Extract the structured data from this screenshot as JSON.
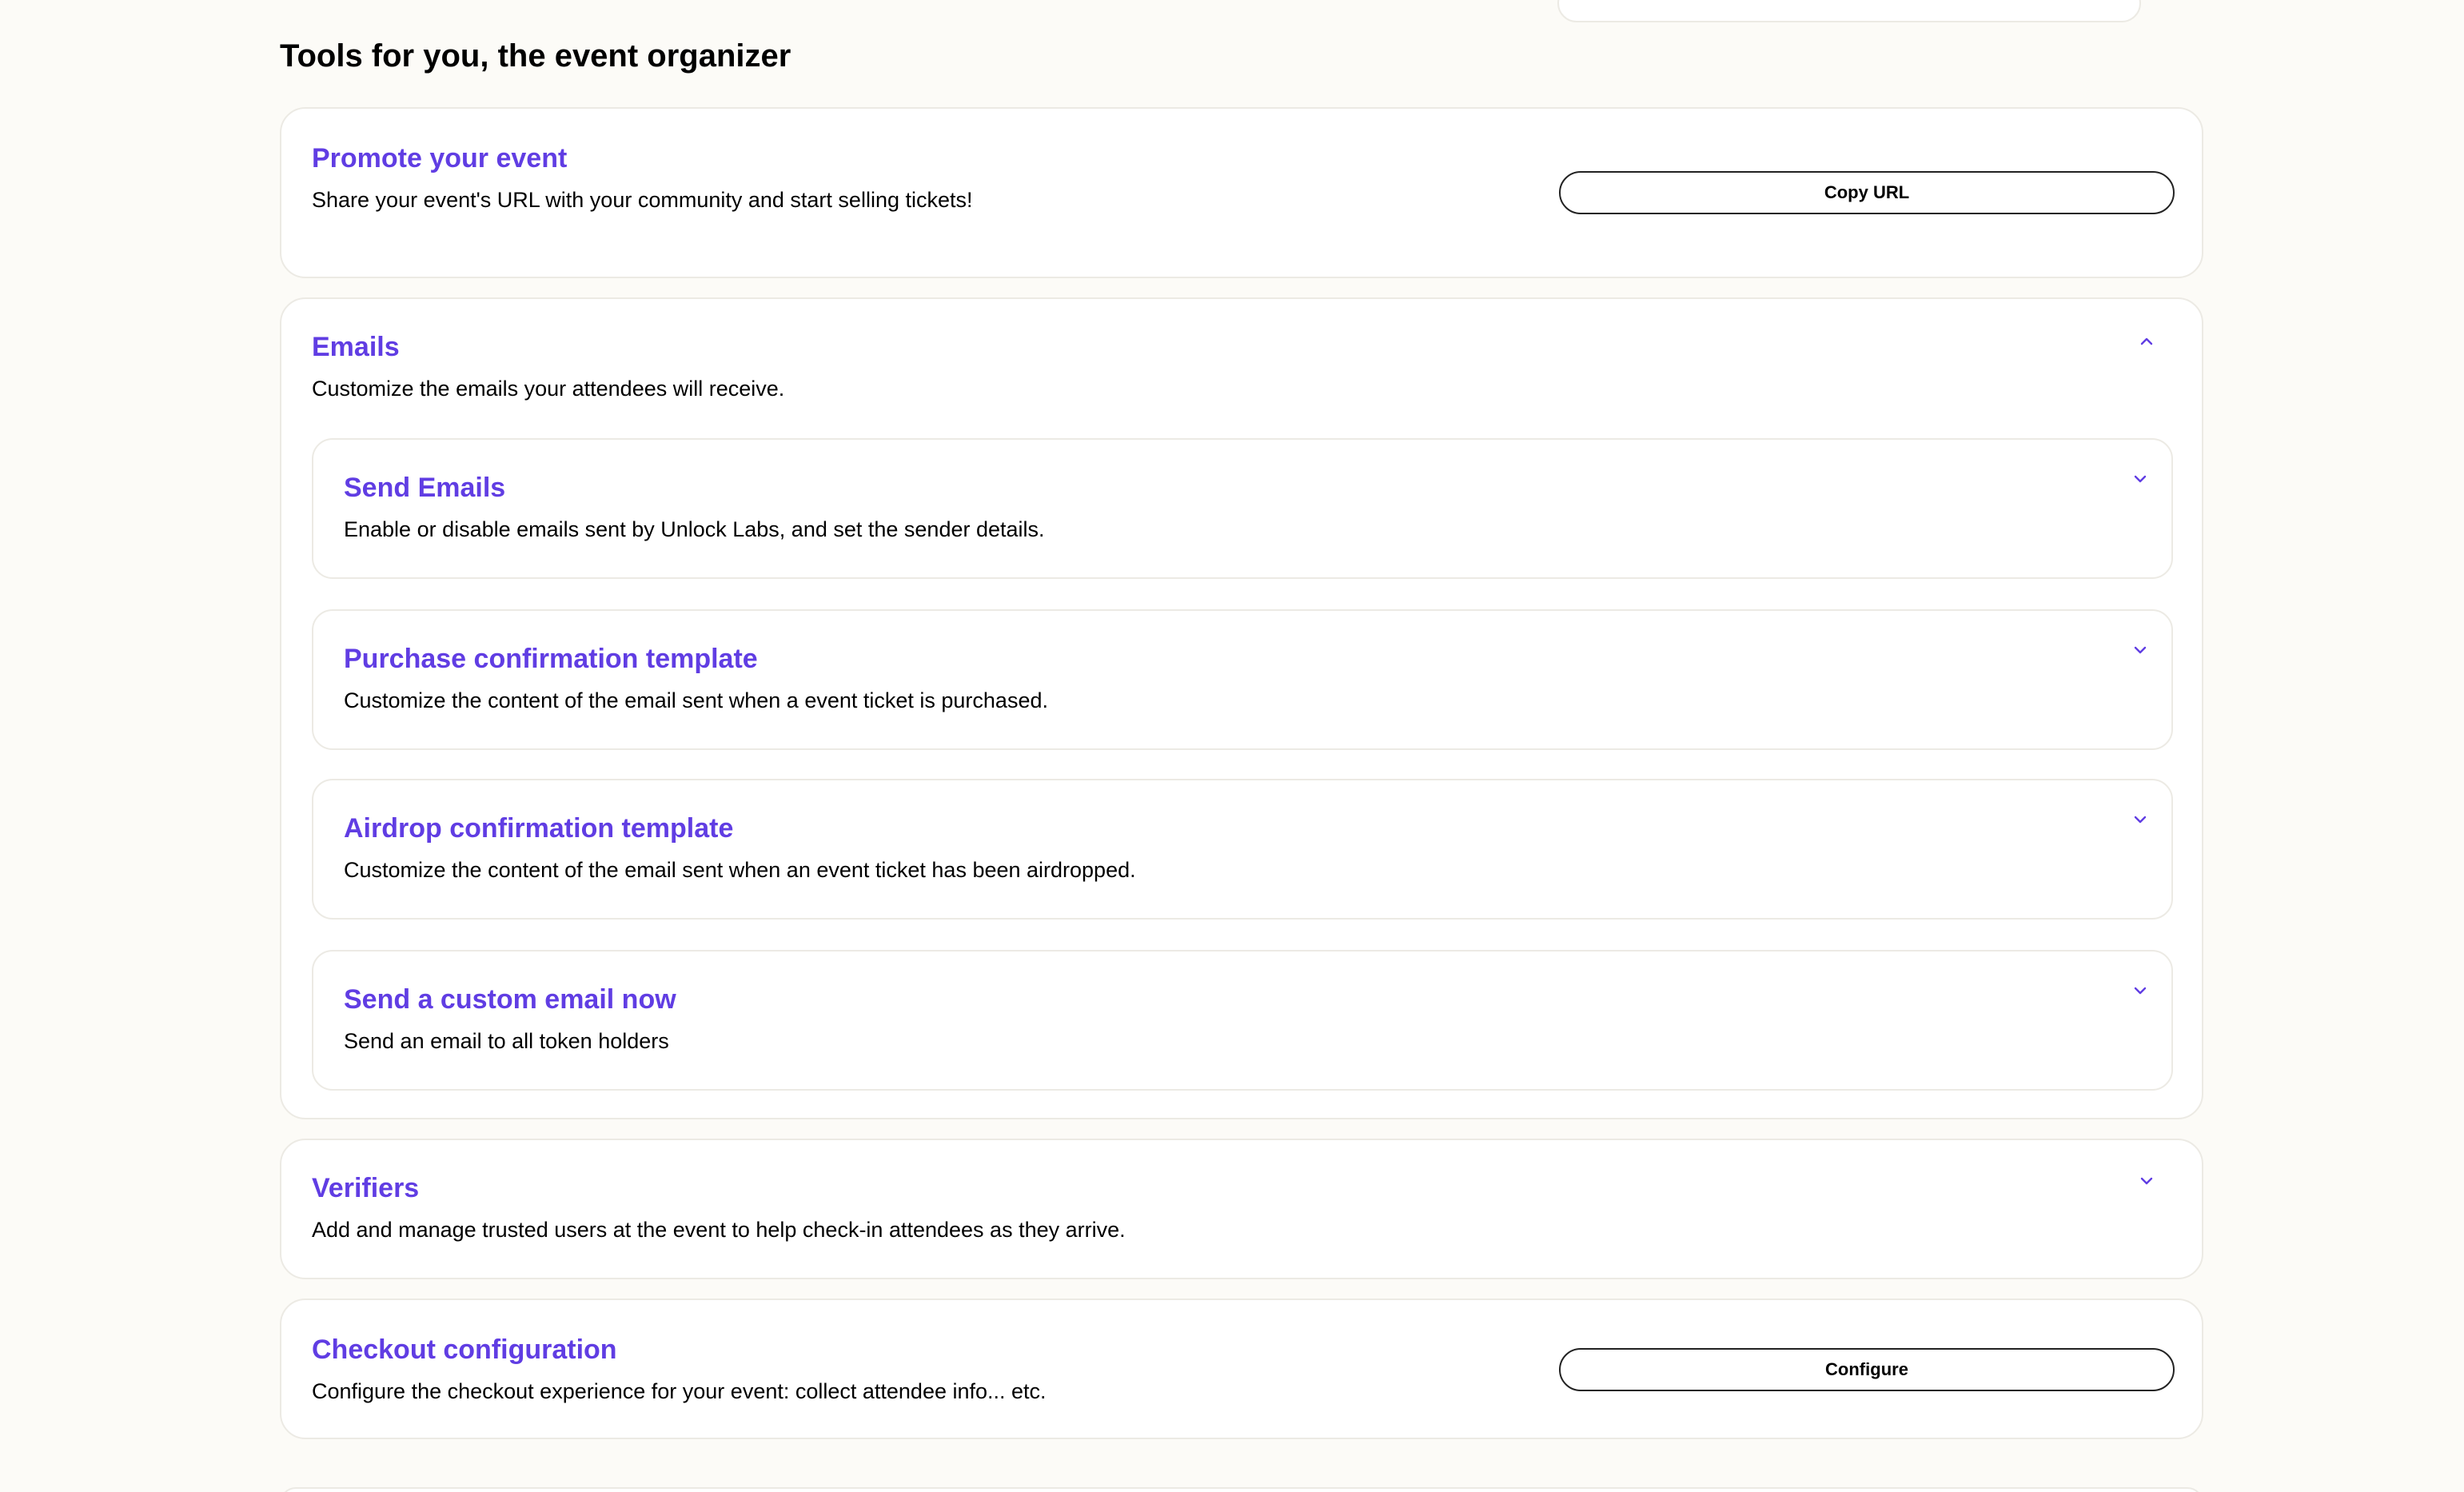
{
  "section": {
    "title": "Tools for you, the event organizer"
  },
  "promote": {
    "title": "Promote your event",
    "description": "Share your event's URL with your community and start selling tickets!",
    "button_label": "Copy URL"
  },
  "emails": {
    "title": "Emails",
    "description": "Customize the emails your attendees will receive.",
    "expanded": true,
    "items": [
      {
        "title": "Send Emails",
        "description": "Enable or disable emails sent by Unlock Labs, and set the sender details."
      },
      {
        "title": "Purchase confirmation template",
        "description": "Customize the content of the email sent when a event ticket is purchased."
      },
      {
        "title": "Airdrop confirmation template",
        "description": "Customize the content of the email sent when an event ticket has been airdropped."
      },
      {
        "title": "Send a custom email now",
        "description": "Send an email to all token holders"
      }
    ]
  },
  "verifiers": {
    "title": "Verifiers",
    "description": "Add and manage trusted users at the event to help check-in attendees as they arrive."
  },
  "checkout": {
    "title": "Checkout configuration",
    "description": "Configure the checkout experience for your event: collect attendee info... etc.",
    "button_label": "Configure"
  },
  "icons": {
    "collapse": "chevron-up-icon",
    "expand": "chevron-down-icon"
  },
  "colors": {
    "accent": "#603de3",
    "page_background": "#fcfbf7",
    "card_border": "#eceae4",
    "card_background": "#ffffff"
  }
}
